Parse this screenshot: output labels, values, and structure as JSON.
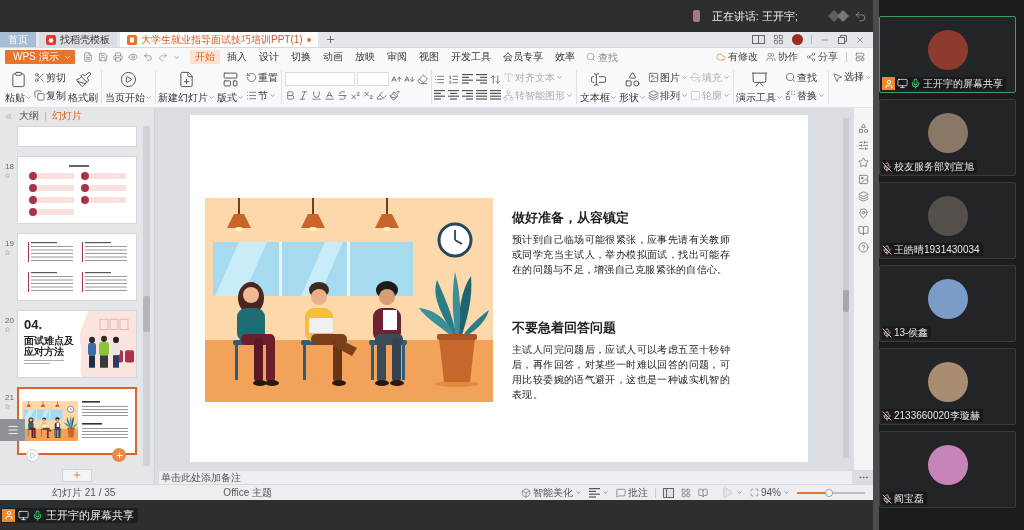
{
  "meeting": {
    "speaker_label": "正在讲话: 王开宇;"
  },
  "tabs": [
    {
      "kind": "home",
      "label": "首页",
      "selected": false,
      "modified": false
    },
    {
      "kind": "template",
      "label": "找稻壳模板",
      "selected": false,
      "modified": false
    },
    {
      "kind": "document",
      "label": "大学生就业指导面试技巧培训PPT(1)",
      "selected": true,
      "modified": true
    }
  ],
  "app_menu": {
    "label": "WPS 演示"
  },
  "menu": [
    {
      "label": "开始",
      "selected": true
    },
    {
      "label": "插入",
      "selected": false
    },
    {
      "label": "设计",
      "selected": false
    },
    {
      "label": "切换",
      "selected": false
    },
    {
      "label": "动画",
      "selected": false
    },
    {
      "label": "放映",
      "selected": false
    },
    {
      "label": "审阅",
      "selected": false
    },
    {
      "label": "视图",
      "selected": false
    },
    {
      "label": "开发工具",
      "selected": false
    },
    {
      "label": "会员专享",
      "selected": false
    },
    {
      "label": "效率",
      "selected": false
    }
  ],
  "search": {
    "placeholder": "查找"
  },
  "account_actions": [
    {
      "kind": "changes",
      "label": "有修改"
    },
    {
      "kind": "collaborate",
      "label": "协作"
    },
    {
      "kind": "share",
      "label": "分享"
    }
  ],
  "ribbon": [
    {
      "kind": "large",
      "label": "粘贴",
      "dropdown": true,
      "disabled": false
    },
    {
      "kind": "stack",
      "items": [
        {
          "label": "剪切",
          "dropdown": false,
          "disabled": false
        },
        {
          "label": "复制",
          "dropdown": false,
          "disabled": false
        }
      ]
    },
    {
      "kind": "large",
      "label": "格式刷",
      "dropdown": false,
      "disabled": false
    },
    {
      "kind": "separator"
    },
    {
      "kind": "large",
      "label": "当页开始",
      "dropdown": true,
      "disabled": false
    },
    {
      "kind": "separator"
    },
    {
      "kind": "large",
      "label": "新建幻灯片",
      "dropdown": true,
      "disabled": false
    },
    {
      "kind": "large",
      "label": "版式",
      "dropdown": true,
      "disabled": false
    },
    {
      "kind": "stack",
      "items": [
        {
          "label": "重置",
          "dropdown": false,
          "disabled": false
        },
        {
          "label": "节",
          "dropdown": true,
          "disabled": false
        }
      ]
    },
    {
      "kind": "separator"
    },
    {
      "kind": "font"
    },
    {
      "kind": "separator"
    },
    {
      "kind": "paragraph"
    },
    {
      "kind": "stack",
      "items": [
        {
          "label": "对齐文本",
          "dropdown": true,
          "disabled": true
        },
        {
          "label": "转智能图形",
          "dropdown": true,
          "disabled": true
        }
      ]
    },
    {
      "kind": "separator"
    },
    {
      "kind": "large",
      "label": "文本框",
      "dropdown": true,
      "disabled": false
    },
    {
      "kind": "large",
      "label": "形状",
      "dropdown": true,
      "disabled": false
    },
    {
      "kind": "stack",
      "items": [
        {
          "label": "图片",
          "dropdown": true,
          "disabled": false
        },
        {
          "label": "排列",
          "dropdown": true,
          "disabled": false
        }
      ]
    },
    {
      "kind": "stack",
      "items": [
        {
          "label": "填充",
          "dropdown": true,
          "disabled": true
        },
        {
          "label": "轮廓",
          "dropdown": true,
          "disabled": true
        }
      ]
    },
    {
      "kind": "separator"
    },
    {
      "kind": "large",
      "label": "演示工具",
      "dropdown": true,
      "disabled": false
    },
    {
      "kind": "stack",
      "items": [
        {
          "label": "查找",
          "dropdown": false,
          "disabled": false
        },
        {
          "label": "替换",
          "dropdown": true,
          "disabled": false
        }
      ]
    },
    {
      "kind": "separator"
    },
    {
      "kind": "small",
      "label": "选择",
      "dropdown": true,
      "disabled": false
    }
  ],
  "slides_panel": {
    "tabs": [
      {
        "label": "大纲",
        "selected": false
      },
      {
        "label": "幻灯片",
        "selected": true
      }
    ],
    "slides": [
      {
        "kind": "blank",
        "selected": false
      },
      {
        "kind": "agenda",
        "number": "18",
        "selected": false
      },
      {
        "kind": "text",
        "number": "19",
        "selected": false
      },
      {
        "kind": "section",
        "number": "20",
        "heading": "04.",
        "title": "面试难点及应对方法",
        "selected": false
      },
      {
        "kind": "illustrated",
        "number": "21",
        "selected": true
      }
    ]
  },
  "slide": {
    "blocks": [
      {
        "heading": "做好准备，从容镇定",
        "body": "预计到自己临场可能很紧张，应事先请有关教师或同学充当主试人，举办模拟面试，找出可能存在的问题与不足，增强自己克服紧张的自信心。"
      },
      {
        "heading": "不要急着回答问题",
        "body": "主试人问完问题后，应试人可以考虑五至十秒钟后，再作回答，对某些一时难以回答的问题，可用比较委婉的语气避开，这也是一种诚实机智的表现。"
      }
    ]
  },
  "notes": {
    "placeholder": "单击此处添加备注"
  },
  "status_bar": {
    "slide_counter": "幻灯片 21 / 35",
    "theme": "Office 主题",
    "beautify": "智能美化",
    "comments": "批注",
    "zoom": "94%",
    "zoom_slider": {
      "level": 0.47
    }
  },
  "share_bar": {
    "host": true,
    "sharing": true,
    "muted": false,
    "label": "王开宇的屏幕共享"
  },
  "participants": [
    {
      "name": "王开宇的屏幕共享",
      "speaking": true,
      "host": true,
      "sharing": true,
      "muted": false
    },
    {
      "name": "校友服务部刘宣旭",
      "speaking": false,
      "host": false,
      "sharing": false,
      "muted": true
    },
    {
      "name": "王皓晴1931430034",
      "speaking": false,
      "host": false,
      "sharing": false,
      "muted": true
    },
    {
      "name": "13-侯鑫",
      "speaking": false,
      "host": false,
      "sharing": false,
      "muted": true
    },
    {
      "name": "2133660020李璇赫",
      "speaking": false,
      "host": false,
      "sharing": false,
      "muted": true
    },
    {
      "name": "阎宝磊",
      "speaking": false,
      "host": false,
      "sharing": false,
      "muted": true
    }
  ]
}
